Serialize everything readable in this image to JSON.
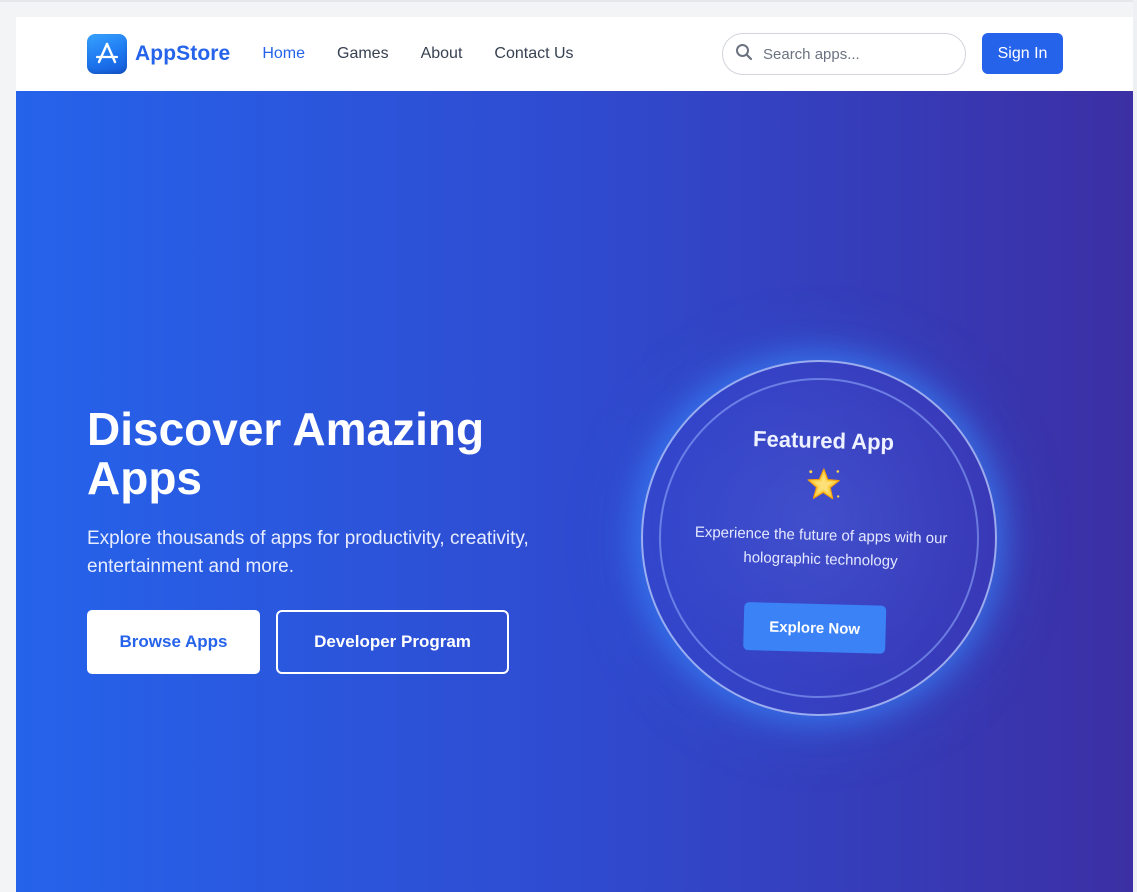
{
  "header": {
    "brand": "AppStore",
    "nav": [
      "Home",
      "Games",
      "About",
      "Contact Us"
    ],
    "active_nav": "Home",
    "search_placeholder": "Search apps...",
    "signin_label": "Sign In"
  },
  "hero": {
    "title": "Discover Amazing Apps",
    "subtitle": "Explore thousands of apps for productivity, creativity, entertainment and more.",
    "browse_label": "Browse Apps",
    "developer_label": "Developer Program"
  },
  "featured": {
    "title": "Featured App",
    "icon": "star-icon",
    "description": "Experience the future of apps with our holographic technology",
    "button_label": "Explore Now"
  },
  "colors": {
    "brand": "#2563eb",
    "hero_start": "#2563eb",
    "hero_end": "#3c2fa4",
    "explore_button": "#3b82f6"
  }
}
